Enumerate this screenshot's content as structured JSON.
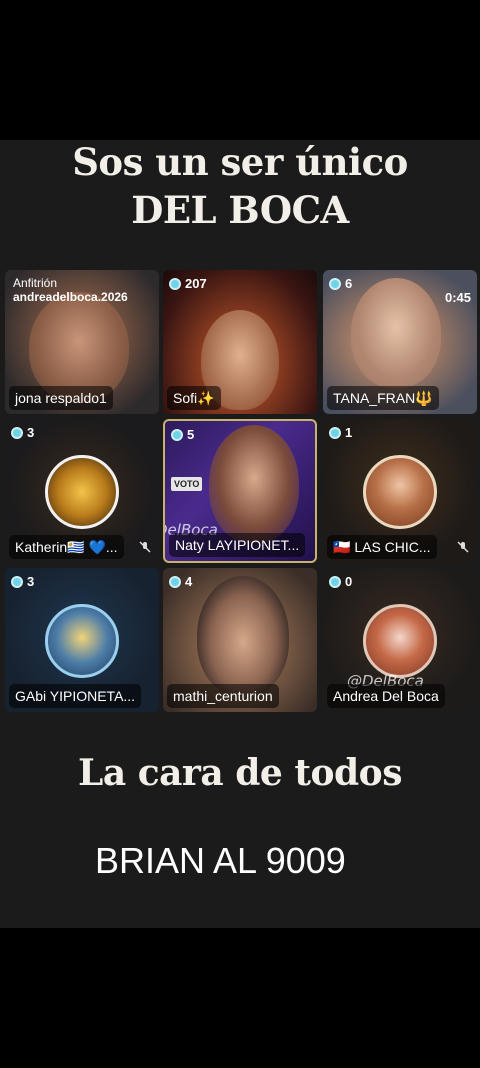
{
  "header": {
    "line1": "Sos un ser único",
    "line2": "DEL BOCA"
  },
  "tiles": {
    "jona": {
      "role": "Anfitrión",
      "host": "andreadelboca.2026",
      "name": "jona respaldo1"
    },
    "sofi": {
      "count": "207",
      "name": "Sofi✨"
    },
    "tana": {
      "count": "6",
      "timer": "0:45",
      "name": "TANA_FRAN🔱"
    },
    "kath": {
      "count": "3",
      "name": "Katherin🇺🇾 💙..."
    },
    "naty": {
      "count": "5",
      "name": "Naty LAYIPIONET...",
      "vote_label": "VOTO"
    },
    "chic": {
      "count": "1",
      "name": "🇨🇱 LAS CHIC..."
    },
    "gabi": {
      "count": "3",
      "name": "GAbi YIPIONETA..."
    },
    "mathi": {
      "count": "4",
      "name": "mathi_centurion"
    },
    "andrea": {
      "count": "0",
      "name": "Andrea Del Boca"
    }
  },
  "watermarks": {
    "mid": "@DelBoca",
    "corner": "@DelBoca"
  },
  "captions": {
    "line1": "La cara de todos",
    "line2": "BRIAN AL 9009"
  },
  "colors": {
    "background": "#000000",
    "panel": "#1c1b1b",
    "viewer_dot": "#6fd2e8"
  },
  "icons": {
    "viewer": "viewer-dot-icon",
    "mic_muted": "mic-muted-icon"
  }
}
